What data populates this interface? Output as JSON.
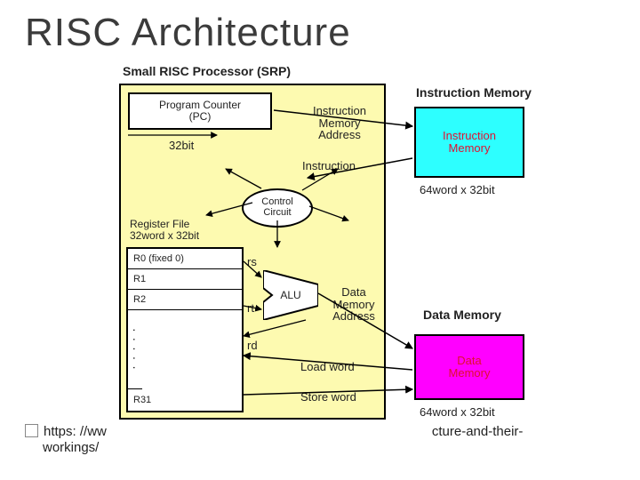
{
  "title": "RISC Architecture",
  "figure_label": "Small RISC Processor (SRP)",
  "pc": {
    "label": "Program Counter\n(PC)",
    "bits": "32bit"
  },
  "labels": {
    "im_addr": "Instruction\nMemory\nAddress",
    "instruction": "Instruction",
    "rs": "rs",
    "rt": "rt",
    "rd": "rd",
    "data_mem_addr": "Data\nMemory\nAddress",
    "load_word": "Load word",
    "store_word": "Store word"
  },
  "control": "Control\nCircuit",
  "regfile": {
    "title": "Register File\n32word x 32bit",
    "rows": [
      "R0 (fixed 0)",
      "R1",
      "R2"
    ],
    "last": "R31"
  },
  "alu": "ALU",
  "im": {
    "title": "Instruction Memory",
    "label": "Instruction\nMemory",
    "bits": "64word x 32bit"
  },
  "dm": {
    "title": "Data Memory",
    "label": "Data\nMemory",
    "bits": "64word x 32bit"
  },
  "footer": {
    "line1_a": "https: //ww",
    "line1_b": "cture-and-their-",
    "line2": "workings/"
  }
}
